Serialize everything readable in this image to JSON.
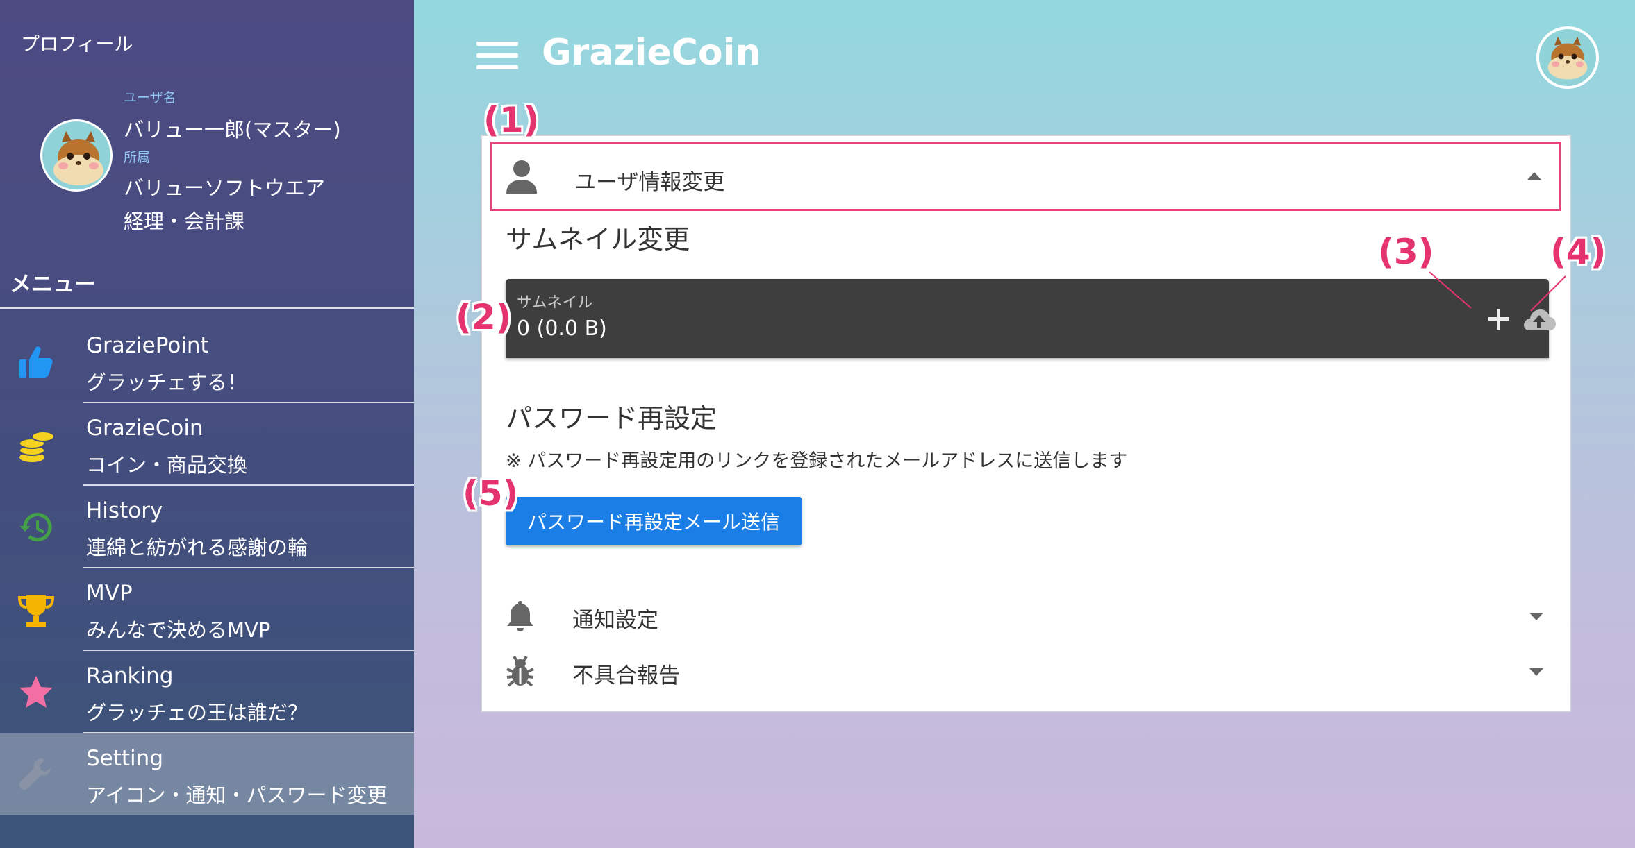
{
  "sidebar": {
    "profile_heading": "プロフィール",
    "username_label": "ユーザ名",
    "username": "バリュー一郎(マスター)",
    "affiliation_label": "所属",
    "company": "バリューソフトウエア",
    "department": "経理・会計課",
    "menu_heading": "メニュー",
    "items": [
      {
        "title": "GraziePoint",
        "sub": "グラッチェする！",
        "icon": "thumbs-up-icon",
        "color": "#2196f3"
      },
      {
        "title": "GrazieCoin",
        "sub": "コイン・商品交換",
        "icon": "coins-icon",
        "color": "#f5d21f"
      },
      {
        "title": "History",
        "sub": "連綿と紡がれる感謝の輪",
        "icon": "history-icon",
        "color": "#43a047"
      },
      {
        "title": "MVP",
        "sub": "みんなで決めるMVP",
        "icon": "trophy-icon",
        "color": "#f5b400"
      },
      {
        "title": "Ranking",
        "sub": "グラッチェの王は誰だ？",
        "icon": "star-icon",
        "color": "#f26fa4"
      },
      {
        "title": "Setting",
        "sub": "アイコン・通知・パスワード変更",
        "icon": "wrench-icon",
        "color": "#8a93a6",
        "active": true
      }
    ]
  },
  "header": {
    "app_title": "GrazieCoin"
  },
  "settings": {
    "user_panel_title": "ユーザ情報変更",
    "thumbnail_section_title": "サムネイル変更",
    "thumbnail_label": "サムネイル",
    "thumbnail_value": "0 (0.0 B)",
    "password_section_title": "パスワード再設定",
    "password_note": "※ パスワード再設定用のリンクを登録されたメールアドレスに送信します",
    "password_button": "パスワード再設定メール送信",
    "notification_title": "通知設定",
    "bug_report_title": "不具合報告"
  },
  "callouts": [
    "(1)",
    "(2)",
    "(3)",
    "(4)",
    "(5)"
  ],
  "colors": {
    "accent": "#1a7ee6",
    "callout": "#e5336f",
    "highlight_border": "#e8427a"
  }
}
